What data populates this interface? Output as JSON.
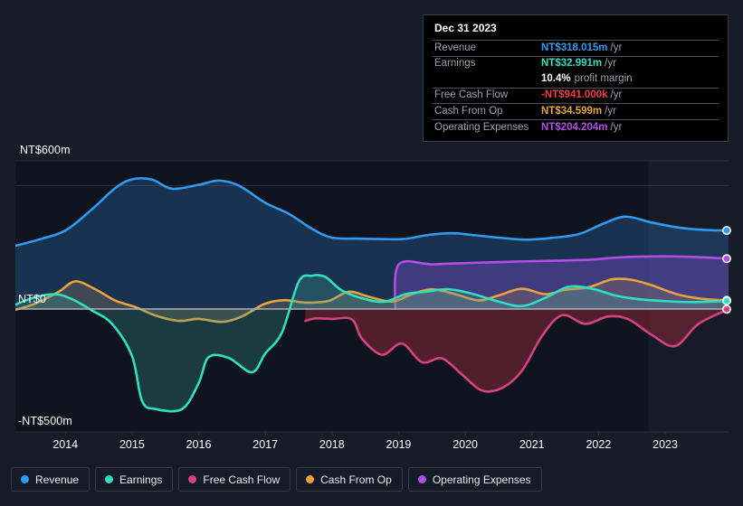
{
  "theme": {
    "background": "#161b28",
    "plot_background": "#10141f",
    "gridline": "#2b3242",
    "zero_line": "#aab0bb",
    "axis_text": "#ffffff",
    "legend_border": "#333a49",
    "tooltip_bg": "#000000",
    "tooltip_border": "#3a3f4b",
    "tooltip_label": "#9aa0ab",
    "highlight_band": "rgba(150,180,220,0.05)"
  },
  "tooltip": {
    "date": "Dec 31 2023",
    "rows": [
      {
        "label": "Revenue",
        "value": "NT$318.015m",
        "unit": "/yr",
        "color": "#2e9bf0"
      },
      {
        "label": "Earnings",
        "value": "NT$32.991m",
        "unit": "/yr",
        "color": "#2ee0c0"
      },
      {
        "label": "",
        "value": "10.4%",
        "sub": "profit margin",
        "color": "#ffffff"
      },
      {
        "label": "Free Cash Flow",
        "value": "-NT$941.000k",
        "unit": "/yr",
        "color": "#f03e3e"
      },
      {
        "label": "Cash From Op",
        "value": "NT$34.599m",
        "unit": "/yr",
        "color": "#e8a33d"
      },
      {
        "label": "Operating Expenses",
        "value": "NT$204.204m",
        "unit": "/yr",
        "color": "#b44ce8"
      }
    ]
  },
  "legend": {
    "items": [
      {
        "label": "Revenue",
        "color": "#2e9bf0"
      },
      {
        "label": "Earnings",
        "color": "#2ee0c0"
      },
      {
        "label": "Free Cash Flow",
        "color": "#d6417f"
      },
      {
        "label": "Cash From Op",
        "color": "#e8a33d"
      },
      {
        "label": "Operating Expenses",
        "color": "#b44ce8"
      }
    ]
  },
  "axes": {
    "y_labels": [
      {
        "text": "NT$600m",
        "value": 600
      },
      {
        "text": "NT$0",
        "value": 0
      },
      {
        "text": "-NT$500m",
        "value": -500
      }
    ],
    "x_labels": [
      "2014",
      "2015",
      "2016",
      "2017",
      "2018",
      "2019",
      "2020",
      "2021",
      "2022",
      "2023"
    ]
  },
  "chart_data": {
    "type": "area",
    "title": "",
    "xlabel": "",
    "ylabel": "",
    "currency": "NT$",
    "ylim": [
      -500,
      600
    ],
    "xlim": [
      2013.25,
      2023.95
    ],
    "grid": true,
    "legend_position": "bottom",
    "gridline_values": [
      600,
      500
    ],
    "zero_line": 0,
    "highlight_band_from": 2022.75,
    "x_tick_values": [
      2014,
      2015,
      2016,
      2017,
      2018,
      2019,
      2020,
      2021,
      2022,
      2023
    ],
    "series": [
      {
        "name": "Revenue",
        "color": "#2e9bf0",
        "fill": "rgba(46,124,196,0.30)",
        "x": [
          2013.25,
          2013.6,
          2014.0,
          2014.4,
          2014.75,
          2015.0,
          2015.3,
          2015.6,
          2016.0,
          2016.3,
          2016.6,
          2017.0,
          2017.35,
          2017.7,
          2018.0,
          2018.4,
          2018.8,
          2019.1,
          2019.45,
          2019.8,
          2020.1,
          2020.5,
          2020.9,
          2021.3,
          2021.7,
          2022.05,
          2022.4,
          2022.8,
          2023.2,
          2023.6,
          2023.95
        ],
        "y": [
          256,
          281,
          318,
          404,
          490,
          525,
          524,
          487,
          503,
          520,
          500,
          430,
          386,
          325,
          289,
          285,
          283,
          284,
          300,
          307,
          300,
          289,
          281,
          288,
          303,
          343,
          374,
          350,
          330,
          320,
          318
        ]
      },
      {
        "name": "Operating Expenses",
        "color": "#b44ce8",
        "fill": "rgba(120,70,190,0.42)",
        "x": [
          2018.95,
          2019.0,
          2019.5,
          2020.0,
          2020.4,
          2020.9,
          2021.4,
          2021.9,
          2022.3,
          2022.8,
          2023.3,
          2023.95
        ],
        "y": [
          0,
          180,
          181,
          186,
          189,
          193,
          196,
          200,
          209,
          213,
          212,
          204
        ]
      },
      {
        "name": "Cash From Op",
        "color": "#e8a33d",
        "fill": "rgba(150,130,95,0.30)",
        "x": [
          2013.25,
          2013.55,
          2013.9,
          2014.15,
          2014.45,
          2014.75,
          2015.05,
          2015.35,
          2015.7,
          2016.0,
          2016.35,
          2016.65,
          2017.0,
          2017.3,
          2017.6,
          2017.95,
          2018.25,
          2018.55,
          2018.9,
          2019.2,
          2019.5,
          2019.85,
          2020.2,
          2020.5,
          2020.85,
          2021.2,
          2021.5,
          2021.85,
          2022.2,
          2022.5,
          2022.8,
          2023.2,
          2023.6,
          2023.95
        ],
        "y": [
          -3,
          22,
          70,
          112,
          80,
          34,
          8,
          -26,
          -48,
          -40,
          -52,
          -30,
          22,
          36,
          26,
          33,
          70,
          50,
          30,
          60,
          80,
          60,
          35,
          55,
          82,
          60,
          78,
          88,
          120,
          118,
          96,
          58,
          40,
          35
        ]
      },
      {
        "name": "Earnings",
        "color": "#2ee0c0",
        "fill": "rgba(60,160,150,0.28)",
        "x": [
          2013.25,
          2013.55,
          2013.85,
          2014.1,
          2014.4,
          2014.7,
          2015.0,
          2015.15,
          2015.35,
          2015.75,
          2016.0,
          2016.15,
          2016.45,
          2016.8,
          2017.0,
          2017.25,
          2017.5,
          2017.7,
          2017.9,
          2018.15,
          2018.5,
          2018.8,
          2019.1,
          2019.4,
          2019.75,
          2020.1,
          2020.5,
          2020.85,
          2021.2,
          2021.55,
          2021.9,
          2022.25,
          2022.6,
          2023.0,
          2023.4,
          2023.95
        ],
        "y": [
          18,
          48,
          60,
          40,
          -6,
          -60,
          -190,
          -372,
          -405,
          -405,
          -300,
          -195,
          -198,
          -256,
          -180,
          -95,
          110,
          135,
          130,
          75,
          40,
          30,
          60,
          70,
          80,
          62,
          30,
          12,
          45,
          90,
          82,
          55,
          40,
          32,
          28,
          33
        ]
      },
      {
        "name": "Free Cash Flow",
        "color": "#d6417f",
        "fill": "rgba(135,40,55,0.55)",
        "x": [
          2017.6,
          2017.75,
          2018.0,
          2018.3,
          2018.45,
          2018.75,
          2019.05,
          2019.35,
          2019.65,
          2019.95,
          2020.25,
          2020.55,
          2020.85,
          2021.15,
          2021.45,
          2021.8,
          2022.15,
          2022.45,
          2022.8,
          2023.15,
          2023.5,
          2023.95
        ],
        "y": [
          -48,
          -38,
          -40,
          -42,
          -120,
          -185,
          -140,
          -215,
          -200,
          -265,
          -330,
          -320,
          -250,
          -110,
          -25,
          -60,
          -30,
          -42,
          -105,
          -150,
          -60,
          -1
        ]
      }
    ]
  }
}
